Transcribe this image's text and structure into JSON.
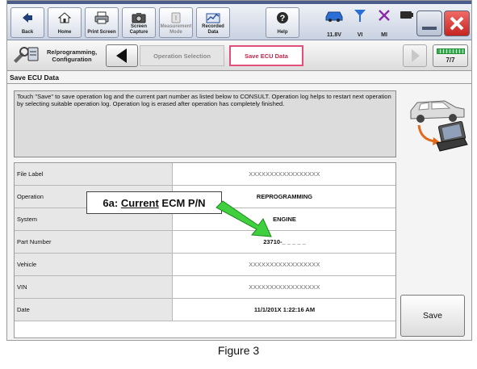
{
  "toolbar": {
    "back_label": "Back",
    "home_label": "Home",
    "print_label": "Print Screen",
    "capture_label": "Screen Capture",
    "measurement_label": "Measurement Mode",
    "recorded_label": "Recorded Data",
    "help_label": "Help",
    "battery_voltage": "11.8V",
    "vi_label": "VI",
    "mi_label": "MI"
  },
  "nav": {
    "reprog_label": "Re/programming, Configuration",
    "crumb_op": "Operation Selection",
    "crumb_save": "Save ECU Data",
    "page_indicator": "7/7"
  },
  "screen": {
    "title": "Save ECU Data",
    "message": "Touch \"Save\" to save operation log and the current part number as listed below to CONSULT. Operation log helps to restart next operation by selecting suitable operation log. Operation log is erased after operation has completely finished."
  },
  "table": {
    "rows": [
      {
        "label": "File Label",
        "value": "XXXXXXXXXXXXXXXXX"
      },
      {
        "label": "Operation",
        "value": "REPROGRAMMING"
      },
      {
        "label": "System",
        "value": "ENGINE"
      },
      {
        "label": "Part Number",
        "value": "23710-_ _ _ _ _"
      },
      {
        "label": "Vehicle",
        "value": "XXXXXXXXXXXXXXXXX"
      },
      {
        "label": "VIN",
        "value": "XXXXXXXXXXXXXXXXX"
      },
      {
        "label": "Date",
        "value": "11/1/201X 1:22:16 AM"
      }
    ]
  },
  "save_label": "Save",
  "callout": {
    "prefix": "6a: ",
    "underlined": "Current",
    "suffix": " ECM P/N"
  },
  "caption": "Figure 3",
  "colors": {
    "highlight_pink": "#e0507a",
    "arrow_green": "#3fcf3f",
    "close_red": "#d9302c"
  }
}
